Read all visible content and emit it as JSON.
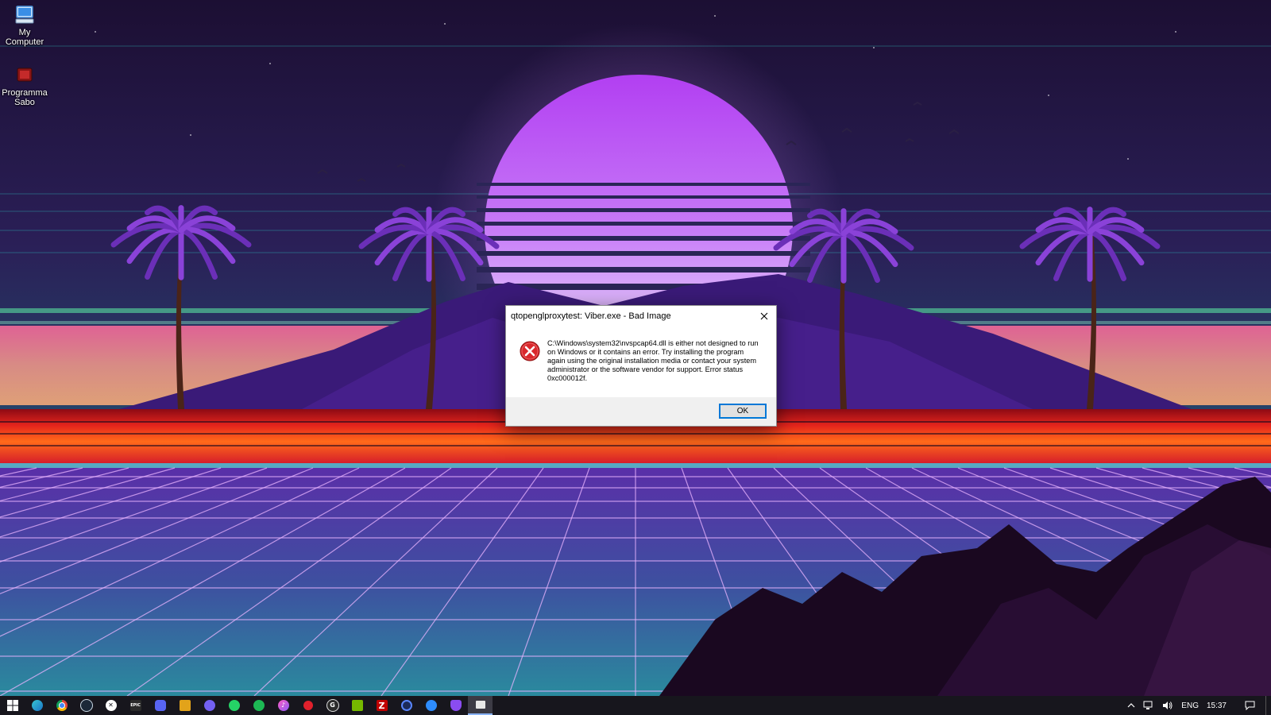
{
  "desktop": {
    "icons": [
      {
        "label": "My\nComputer",
        "icon": "computer-icon"
      },
      {
        "label": "Programma\nSabo",
        "icon": "app-icon"
      }
    ]
  },
  "dialog": {
    "title": "qtopenglproxytest: Viber.exe - Bad Image",
    "message": "C:\\Windows\\system32\\nvspcap64.dll is either not designed to run on Windows or it contains an error. Try installing the program again using the original installation media or contact your system administrator or the software vendor for support. Error status 0xc000012f.",
    "ok_label": "OK",
    "icon": "error-icon"
  },
  "taskbar": {
    "apps": [
      {
        "name": "start-button",
        "icon": "windows-logo-icon"
      },
      {
        "name": "edge",
        "icon": "edge-icon"
      },
      {
        "name": "chrome",
        "icon": "chrome-icon"
      },
      {
        "name": "steam",
        "icon": "steam-icon"
      },
      {
        "name": "xbox",
        "icon": "xbox-icon"
      },
      {
        "name": "epic-games",
        "icon": "epic-games-icon",
        "glyph": "EPIC"
      },
      {
        "name": "discord",
        "icon": "discord-icon"
      },
      {
        "name": "launcher",
        "icon": "launcher-icon"
      },
      {
        "name": "viber",
        "icon": "viber-icon"
      },
      {
        "name": "whatsapp",
        "icon": "whatsapp-icon"
      },
      {
        "name": "spotify",
        "icon": "spotify-icon"
      },
      {
        "name": "itunes",
        "icon": "itunes-icon"
      },
      {
        "name": "red-app",
        "icon": "red-app-icon"
      },
      {
        "name": "g-app",
        "icon": "g-app-icon"
      },
      {
        "name": "nvidia",
        "icon": "nvidia-icon"
      },
      {
        "name": "filezilla",
        "icon": "filezilla-icon",
        "glyph": "Z"
      },
      {
        "name": "circle-app",
        "icon": "circle-app-icon"
      },
      {
        "name": "messenger",
        "icon": "messenger-icon"
      },
      {
        "name": "vpn",
        "icon": "vpn-icon"
      },
      {
        "name": "active-window",
        "icon": "window-icon"
      }
    ],
    "tray": {
      "language": "ENG",
      "time": "15:37"
    }
  }
}
